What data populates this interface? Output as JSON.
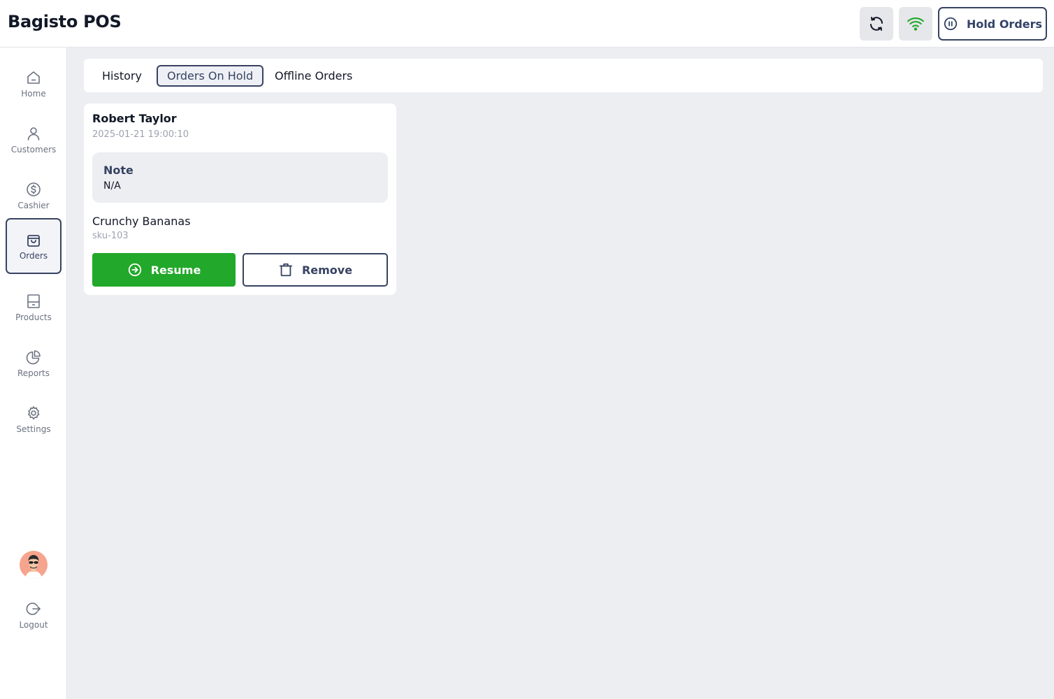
{
  "app": {
    "title": "Bagisto POS"
  },
  "header": {
    "sync_icon": "refresh-icon",
    "network_icon": "wifi-icon",
    "hold_orders_label": "Hold Orders"
  },
  "sidebar": {
    "items": [
      {
        "label": "Home",
        "icon": "home-icon",
        "active": false
      },
      {
        "label": "Customers",
        "icon": "user-icon",
        "active": false
      },
      {
        "label": "Cashier",
        "icon": "dollar-circle-icon",
        "active": false
      },
      {
        "label": "Orders",
        "icon": "shopping-bag-icon",
        "active": true
      },
      {
        "label": "Products",
        "icon": "product-box-icon",
        "active": false
      },
      {
        "label": "Reports",
        "icon": "pie-chart-icon",
        "active": false
      },
      {
        "label": "Settings",
        "icon": "gear-icon",
        "active": false
      }
    ],
    "logout_label": "Logout"
  },
  "tabs": {
    "history": "History",
    "orders_on_hold": "Orders On Hold",
    "offline_orders": "Offline Orders",
    "active": "Orders On Hold"
  },
  "hold_order": {
    "customer_name": "Robert Taylor",
    "timestamp": "2025-01-21 19:00:10",
    "note_label": "Note",
    "note_value": "N/A",
    "product_name": "Crunchy Bananas",
    "product_sku": "sku-103",
    "resume_label": "Resume",
    "remove_label": "Remove"
  },
  "colors": {
    "accent": "#374362",
    "success": "#22a82a",
    "wifi": "#22a82a",
    "background": "#eceef2"
  }
}
